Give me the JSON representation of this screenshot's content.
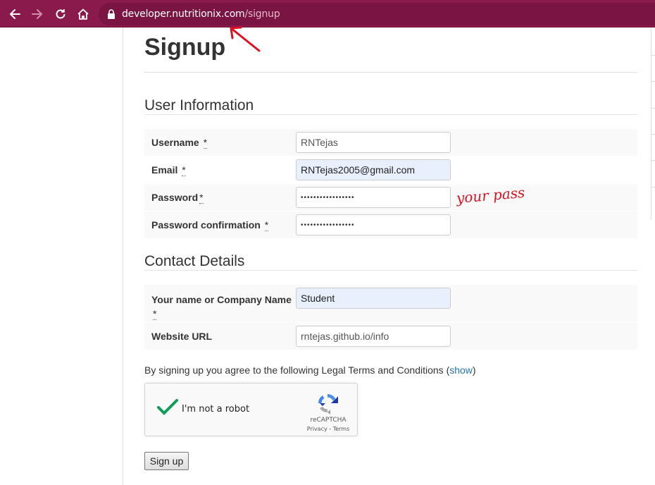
{
  "browser": {
    "url_host": "developer.nutritionix.com",
    "url_path": "/signup"
  },
  "page": {
    "title": "Signup"
  },
  "user_info": {
    "heading": "User Information",
    "fields": [
      {
        "label": "Username",
        "value": "RNTejas"
      },
      {
        "label": "Email",
        "value": "RNTejas2005@gmail.com"
      },
      {
        "label": "Password",
        "value": "•••••••••••••••••"
      },
      {
        "label": "Password confirmation",
        "value": "•••••••••••••••••"
      }
    ]
  },
  "contact": {
    "heading": "Contact Details",
    "fields": [
      {
        "label": "Your name or Company Name",
        "value": "Student"
      },
      {
        "label": "Website URL",
        "value": "rntejas.github.io/info"
      }
    ]
  },
  "required_mark": "*",
  "terms": {
    "prefix": "By signing up you agree to the following Legal Terms and Conditions (",
    "link": "show",
    "suffix": ")"
  },
  "recaptcha": {
    "label": "I'm not a robot",
    "brand": "reCAPTCHA",
    "privacy": "Privacy",
    "separator": " - ",
    "terms": "Terms"
  },
  "submit_label": "Sign up",
  "annotation_text": "your pass",
  "colors": {
    "browser_bar": "#8a1a4c",
    "link": "#1e73be",
    "annotation": "#e01020",
    "check": "#0f9d58"
  }
}
